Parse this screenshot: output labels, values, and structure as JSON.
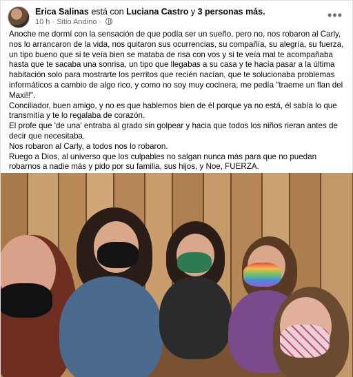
{
  "header": {
    "author": "Erica Salinas",
    "with_text": "está con",
    "tagged": "Luciana Castro",
    "and_text": "y",
    "others": "3 personas más.",
    "time": "10 h",
    "separator": "·",
    "location": "Sitio Andino",
    "separator2": "·",
    "more_label": "•••"
  },
  "post": {
    "paragraphs": [
      "Anoche me dormí con la sensación de que podía ser un sueño, pero no, nos robaron al Carly, nos lo arrancaron de la vida, nos quitaron sus ocurrencias, su compañía, su alegría, su fuerza, un tipo bueno que si te veía bien se mataba de risa con vos y si te veía mal te acompañaba hasta que te sacaba una sonrisa, un tipo que llegabas a su casa y te hacía pasar a la última habitación solo para mostrarte los perritos que recién nacían, que te solucionaba problemas informáticos a cambio de algo rico, y como no soy muy cocinera, me pedía \"traeme un flan del Maxi!!\".",
      "Conciliador, buen amigo, y no es que hablemos bien de él porque ya no está, él sabía lo que transmitía y te lo regalaba de corazón.",
      " El profe que 'de una' entraba al grado sin golpear y hacia que todos los niños rieran antes de decir que necesitaba.",
      "Nos robaron al Carly, a todos nos lo robaron.",
      "Ruego a Dios, al universo que los culpables no salgan nunca más para que no puedan robarnos a nadie más y pido por su familia, sus hijos, y Noe, FUERZA."
    ]
  },
  "colors": {
    "text": "#050505",
    "secondary": "#65676b",
    "wood": "#c49a66"
  },
  "icons": {
    "privacy": "globe-icon",
    "menu": "more-options-icon"
  }
}
